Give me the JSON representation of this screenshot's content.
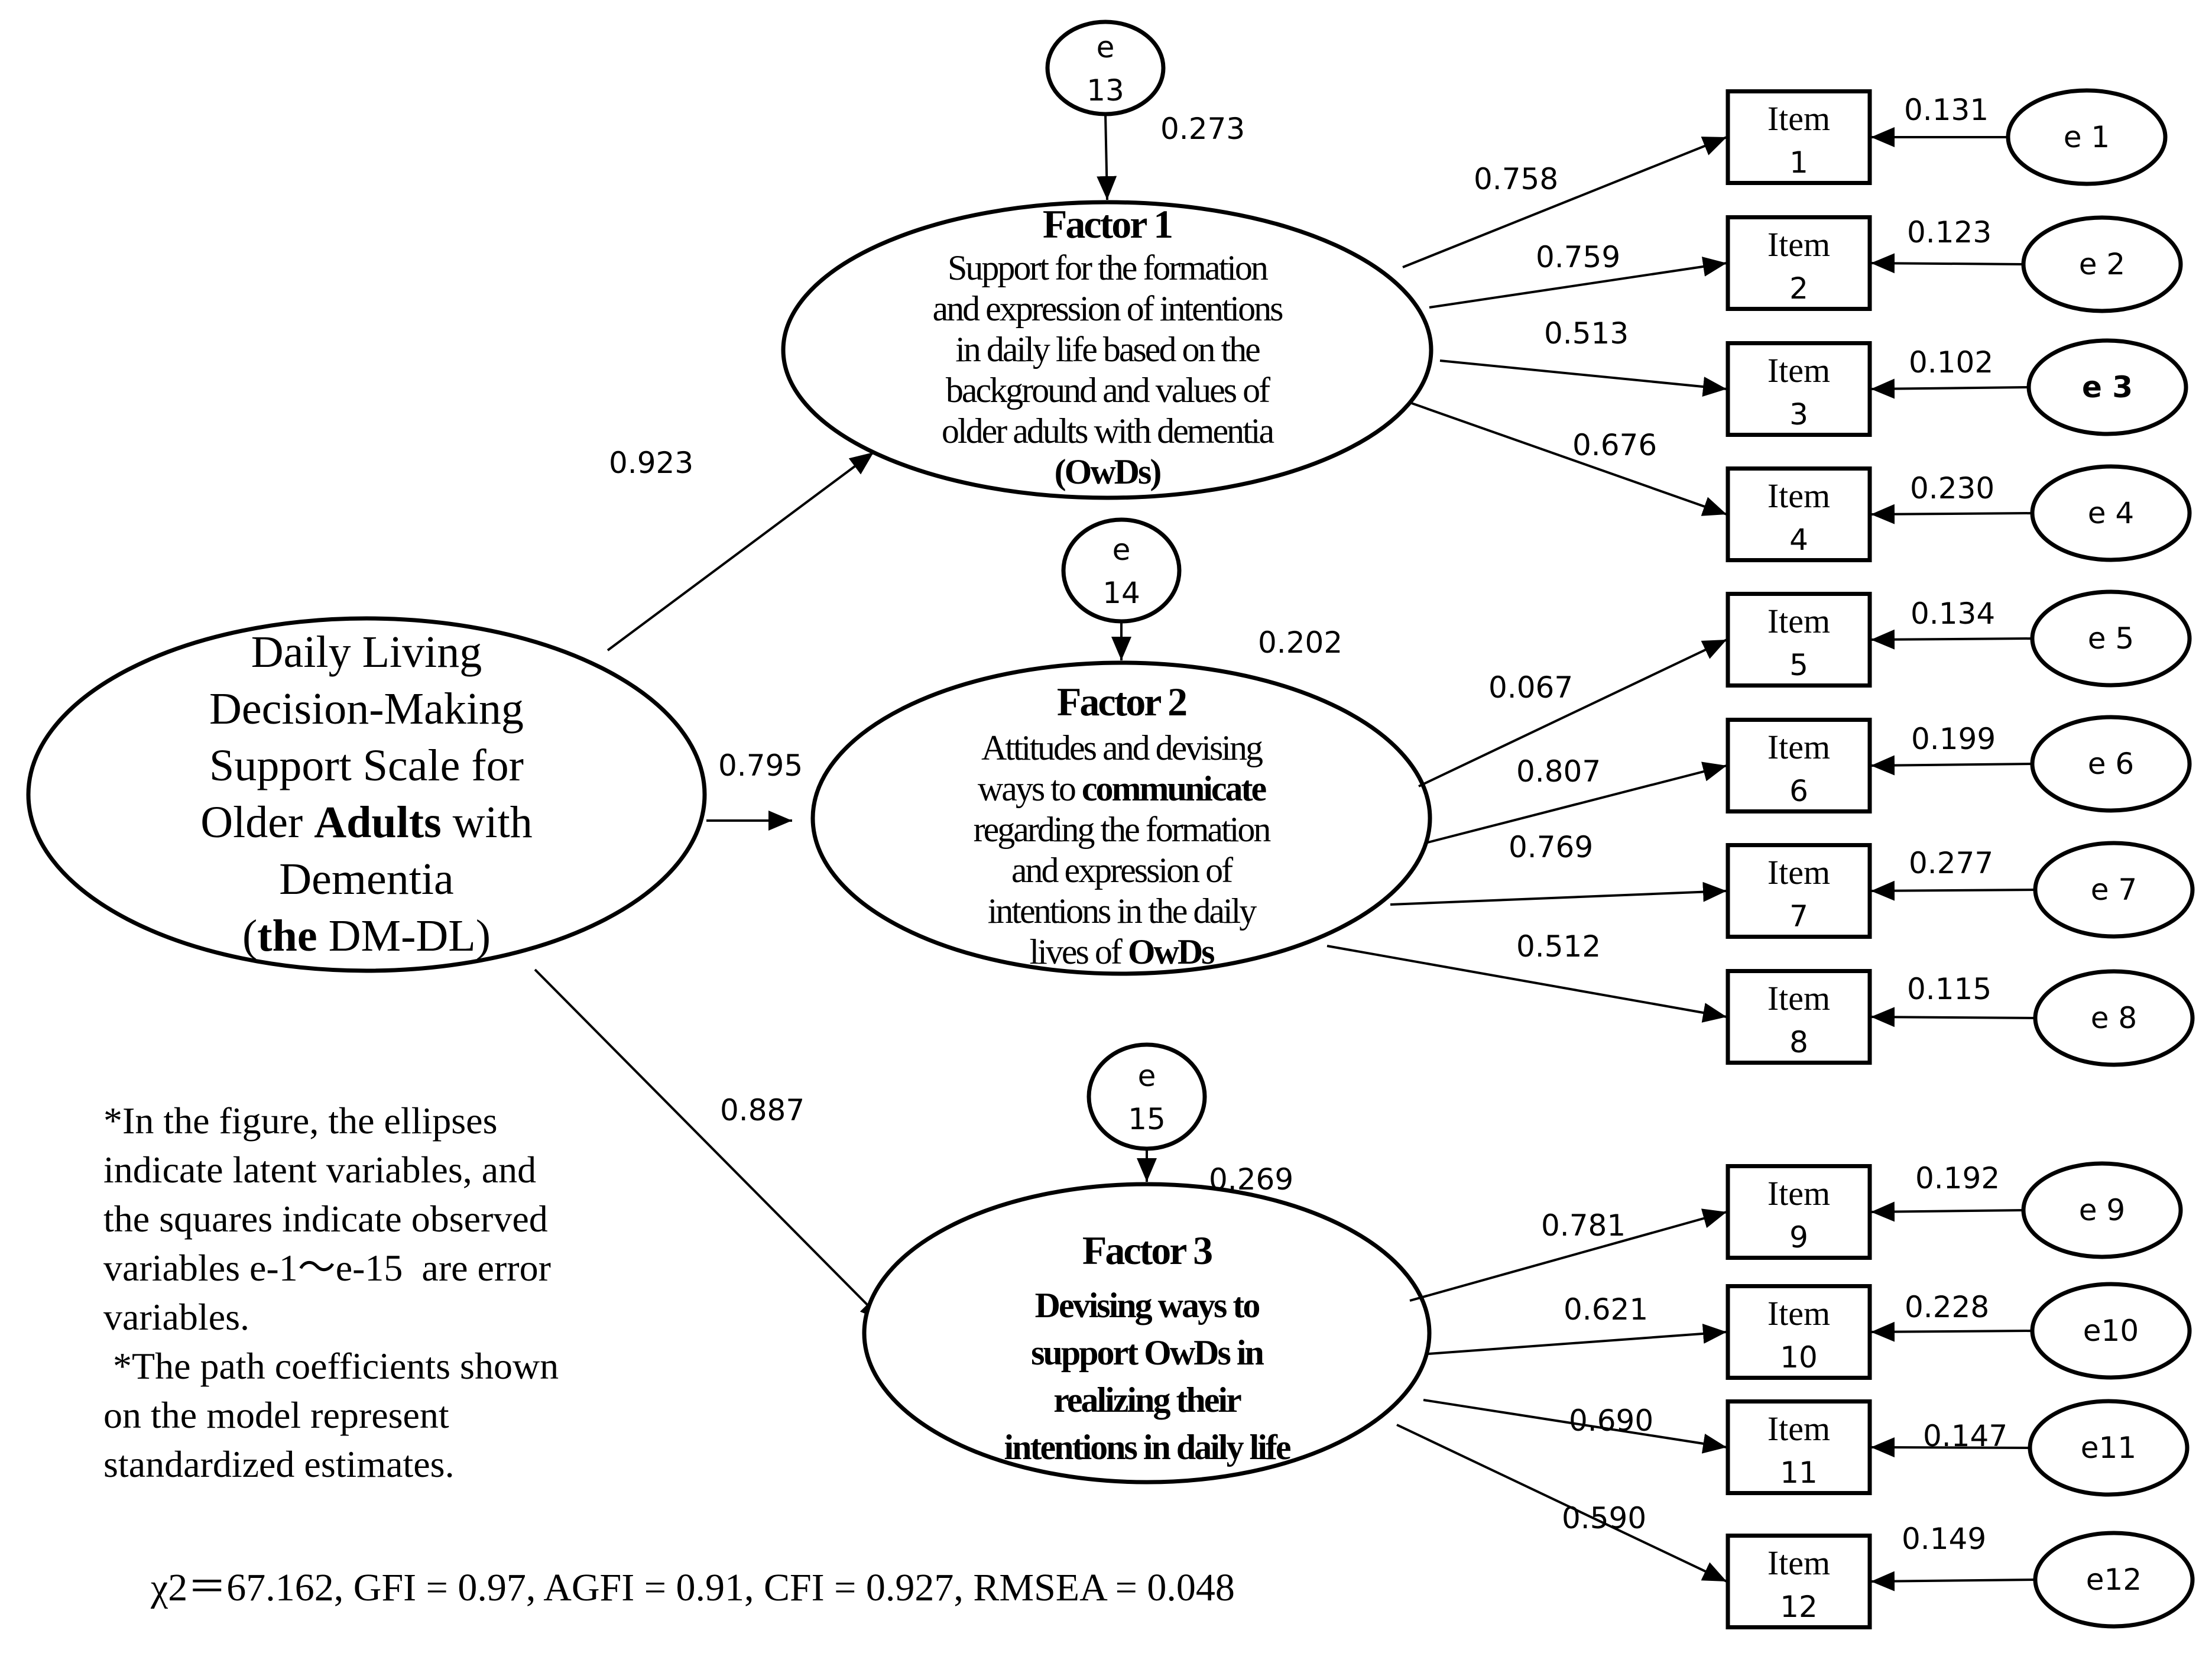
{
  "main_construct": {
    "lines": [
      [
        {
          "t": "Daily Living",
          "b": false
        }
      ],
      [
        {
          "t": "Decision-Making",
          "b": false
        }
      ],
      [
        {
          "t": "Support Scale for",
          "b": false
        }
      ],
      [
        {
          "t": "Older ",
          "b": false
        },
        {
          "t": "Adults",
          "b": true
        },
        {
          "t": " with",
          "b": false
        }
      ],
      [
        {
          "t": "Dementia",
          "b": false
        }
      ],
      [
        {
          "t": "(",
          "b": false
        },
        {
          "t": "the",
          "b": true
        },
        {
          "t": " DM-DL)",
          "b": false
        }
      ]
    ]
  },
  "factors": [
    {
      "title": "Factor 1",
      "lines": [
        [
          {
            "t": "Support for the formation",
            "b": false
          }
        ],
        [
          {
            "t": "and expression of intentions",
            "b": false
          }
        ],
        [
          {
            "t": "in daily life based on the",
            "b": false
          }
        ],
        [
          {
            "t": "background and values of",
            "b": false
          }
        ],
        [
          {
            "t": "older adults with dementia",
            "b": false
          }
        ],
        [
          {
            "t": "(OwDs)",
            "b": true
          }
        ]
      ],
      "path_from_main": "0.923",
      "disturbance": {
        "label_top": "e",
        "label_bottom": "13",
        "coefficient": "0.273"
      }
    },
    {
      "title": "Factor 2",
      "lines": [
        [
          {
            "t": "Attitudes and devising",
            "b": false
          }
        ],
        [
          {
            "t": "ways to ",
            "b": false
          },
          {
            "t": "communicate",
            "b": true
          }
        ],
        [
          {
            "t": "regarding the formation",
            "b": false
          }
        ],
        [
          {
            "t": "and expression of",
            "b": false
          }
        ],
        [
          {
            "t": "intentions in the daily",
            "b": false
          }
        ],
        [
          {
            "t": "lives of ",
            "b": false
          },
          {
            "t": "OwDs",
            "b": true
          }
        ]
      ],
      "path_from_main": "0.795",
      "disturbance": {
        "label_top": "e",
        "label_bottom": "14",
        "coefficient": "0.202"
      }
    },
    {
      "title": "Factor 3",
      "lines": [
        [
          {
            "t": "Devising ways to",
            "b": true
          }
        ],
        [
          {
            "t": "support OwDs in",
            "b": true
          }
        ],
        [
          {
            "t": "realizing their",
            "b": true
          }
        ],
        [
          {
            "t": "intentions in daily life",
            "b": true
          }
        ]
      ],
      "path_from_main": "0.887",
      "disturbance": {
        "label_top": "e",
        "label_bottom": "15",
        "coefficient": "0.269"
      }
    }
  ],
  "items": [
    {
      "label": "Item",
      "number": "1",
      "loading": "0.758",
      "error_label": "e 1",
      "error_coef": "0.131",
      "error_bold": false
    },
    {
      "label": "Item",
      "number": "2",
      "loading": "0.759",
      "error_label": "e 2",
      "error_coef": "0.123",
      "error_bold": false
    },
    {
      "label": "Item",
      "number": "3",
      "loading": "0.513",
      "error_label": "e 3",
      "error_coef": "0.102",
      "error_bold": true
    },
    {
      "label": "Item",
      "number": "4",
      "loading": "0.676",
      "error_label": "e 4",
      "error_coef": "0.230",
      "error_bold": false
    },
    {
      "label": "Item",
      "number": "5",
      "loading": "0.067",
      "error_label": "e 5",
      "error_coef": "0.134",
      "error_bold": false
    },
    {
      "label": "Item",
      "number": "6",
      "loading": "0.807",
      "error_label": "e 6",
      "error_coef": "0.199",
      "error_bold": false
    },
    {
      "label": "Item",
      "number": "7",
      "loading": "0.769",
      "error_label": "e 7",
      "error_coef": "0.277",
      "error_bold": false
    },
    {
      "label": "Item",
      "number": "8",
      "loading": "0.512",
      "error_label": "e 8",
      "error_coef": "0.115",
      "error_bold": false
    },
    {
      "label": "Item",
      "number": "9",
      "loading": "0.781",
      "error_label": "e 9",
      "error_coef": "0.192",
      "error_bold": false
    },
    {
      "label": "Item",
      "number": "10",
      "loading": "0.621",
      "error_label": "e10",
      "error_coef": "0.228",
      "error_bold": false
    },
    {
      "label": "Item",
      "number": "11",
      "loading": "0.690",
      "error_label": "e11",
      "error_coef": "0.147",
      "error_bold": false
    },
    {
      "label": "Item",
      "number": "12",
      "loading": "0.590",
      "error_label": "e12",
      "error_coef": "0.149",
      "error_bold": false
    }
  ],
  "notes": [
    "*In the figure, the ellipses",
    "indicate latent variables, and",
    "the squares indicate observed",
    "variables e-1〜e-15  are error",
    "variables.",
    " *The path coefficients shown",
    "on the model represent",
    "standardized estimates."
  ],
  "fit_indices": "χ2＝67.162, GFI = 0.97, AGFI = 0.91, CFI = 0.927, RMSEA = 0.048"
}
